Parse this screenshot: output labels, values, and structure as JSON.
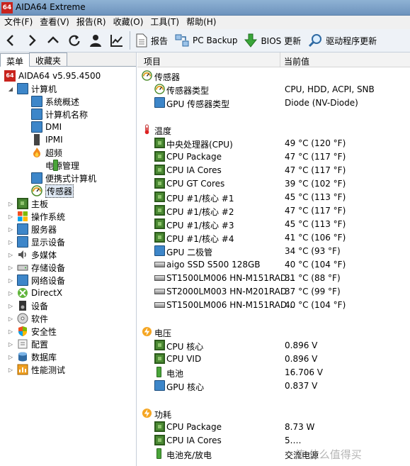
{
  "app": {
    "title": "AIDA64 Extreme",
    "icon_text": "64"
  },
  "menu": [
    "文件(F)",
    "查看(V)",
    "报告(R)",
    "收藏(O)",
    "工具(T)",
    "帮助(H)"
  ],
  "toolbar": {
    "report": "报告",
    "pc_backup": "PC Backup",
    "bios_update": "BIOS 更新",
    "driver_update": "驱动程序更新"
  },
  "left_tabs": [
    "菜单",
    "收藏夹"
  ],
  "tree": {
    "root": "AIDA64 v5.95.4500",
    "computer": "计算机",
    "computer_children": [
      "系统概述",
      "计算机名称",
      "DMI",
      "IPMI",
      "超频",
      "电源管理",
      "便携式计算机",
      "传感器"
    ],
    "categories": [
      "主板",
      "操作系统",
      "服务器",
      "显示设备",
      "多媒体",
      "存储设备",
      "网络设备",
      "DirectX",
      "设备",
      "软件",
      "安全性",
      "配置",
      "数据库",
      "性能测试"
    ]
  },
  "columns": {
    "item": "项目",
    "value": "当前值"
  },
  "sections": {
    "sensor": {
      "title": "传感器",
      "rows": [
        {
          "label": "传感器类型",
          "value": "CPU, HDD, ACPI, SNB"
        },
        {
          "label": "GPU 传感器类型",
          "value": "Diode  (NV-Diode)"
        }
      ]
    },
    "temperature": {
      "title": "温度",
      "rows": [
        {
          "label": "中央处理器(CPU)",
          "value": "49 °C  (120 °F)"
        },
        {
          "label": "CPU Package",
          "value": "47 °C  (117 °F)"
        },
        {
          "label": "CPU IA Cores",
          "value": "47 °C  (117 °F)"
        },
        {
          "label": "CPU GT Cores",
          "value": "39 °C  (102 °F)"
        },
        {
          "label": "CPU #1/核心 #1",
          "value": "45 °C  (113 °F)"
        },
        {
          "label": "CPU #1/核心 #2",
          "value": "47 °C  (117 °F)"
        },
        {
          "label": "CPU #1/核心 #3",
          "value": "45 °C  (113 °F)"
        },
        {
          "label": "CPU #1/核心 #4",
          "value": "41 °C  (106 °F)"
        },
        {
          "label": "GPU 二极管",
          "value": "34 °C  (93 °F)"
        },
        {
          "label": "aigo SSD S500 128GB",
          "value": "40 °C  (104 °F)"
        },
        {
          "label": "ST1500LM006 HN-M151RAD...",
          "value": "31 °C  (88 °F)"
        },
        {
          "label": "ST2000LM003 HN-M201RAD",
          "value": "37 °C  (99 °F)"
        },
        {
          "label": "ST1500LM006 HN-M151RAD...",
          "value": "40 °C  (104 °F)"
        }
      ]
    },
    "voltage": {
      "title": "电压",
      "rows": [
        {
          "label": "CPU 核心",
          "value": "0.896 V"
        },
        {
          "label": "CPU VID",
          "value": "0.896 V"
        },
        {
          "label": "电池",
          "value": "16.706 V"
        },
        {
          "label": "GPU 核心",
          "value": "0.837 V"
        }
      ]
    },
    "power": {
      "title": "功耗",
      "rows": [
        {
          "label": "CPU Package",
          "value": "8.73 W"
        },
        {
          "label": "CPU IA Cores",
          "value": "5.…"
        },
        {
          "label": "电池充/放电",
          "value": "交流电源"
        }
      ]
    }
  },
  "watermark": "值 什么值得买"
}
